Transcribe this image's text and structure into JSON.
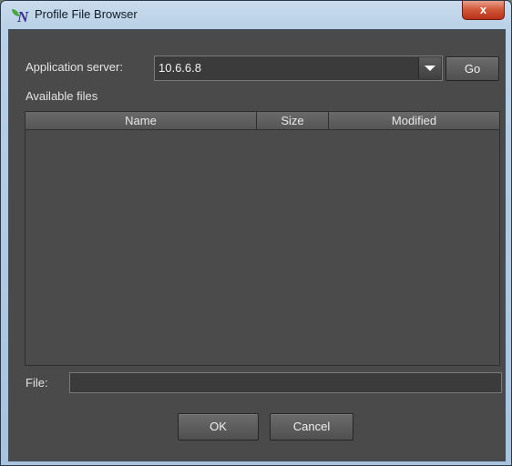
{
  "window": {
    "title": "Profile File Browser",
    "close_label": "x",
    "icon_name": "nv-app-icon"
  },
  "server": {
    "label": "Application server:",
    "value": "10.6.6.8",
    "go_label": "Go"
  },
  "files": {
    "section_label": "Available files",
    "columns": [
      "Name",
      "Size",
      "Modified"
    ],
    "rows": []
  },
  "file": {
    "label": "File:",
    "value": ""
  },
  "buttons": {
    "ok": "OK",
    "cancel": "Cancel"
  },
  "colors": {
    "panel_bg": "#4a4a4a",
    "titlebar": "#b9d0e6",
    "close_button": "#d25a3c"
  }
}
